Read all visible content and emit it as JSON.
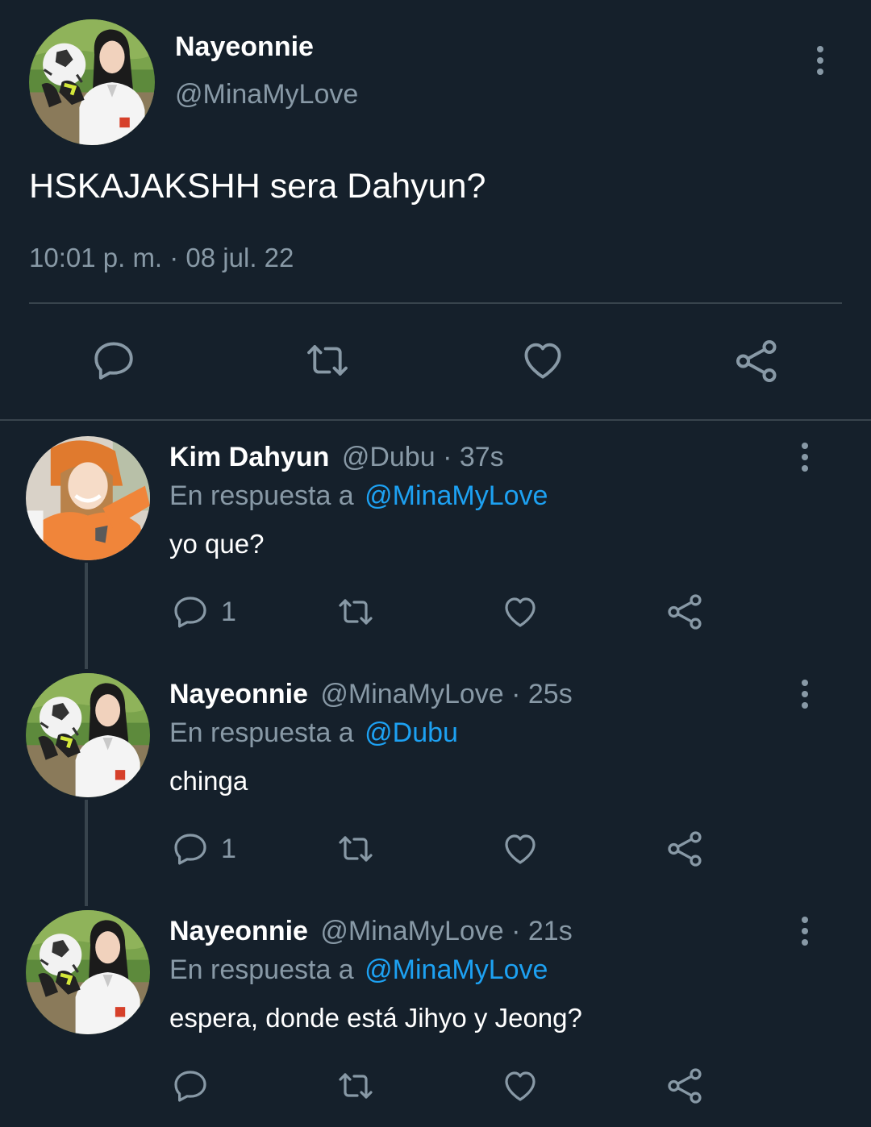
{
  "main_tweet": {
    "display_name": "Nayeonnie",
    "handle": "@MinaMyLove",
    "text": "HSKAJAKSHH sera Dahyun?",
    "timestamp": "10:01 p. m. · 08 jul. 22"
  },
  "replies": [
    {
      "display_name": "Kim Dahyun",
      "handle": "@Dubu",
      "time": "· 37s",
      "reply_prefix": "En respuesta a",
      "reply_to": "@MinaMyLove",
      "text": "yo que?",
      "reply_count": "1"
    },
    {
      "display_name": "Nayeonnie",
      "handle": "@MinaMyLove",
      "time": "· 25s",
      "reply_prefix": "En respuesta a",
      "reply_to": "@Dubu",
      "text": "chinga",
      "reply_count": "1"
    },
    {
      "display_name": "Nayeonnie",
      "handle": "@MinaMyLove",
      "time": "· 21s",
      "reply_prefix": "En respuesta a",
      "reply_to": "@MinaMyLove",
      "text": "espera, donde está Jihyo y Jeong?",
      "reply_count": ""
    }
  ],
  "icons": {
    "reply": "speech-bubble-icon",
    "retweet": "retweet-icon",
    "like": "heart-icon",
    "share": "share-icon",
    "more": "kebab-menu-icon"
  },
  "colors": {
    "background": "#15202b",
    "text": "#ffffff",
    "muted": "#8899a6",
    "link": "#1da1f2",
    "divider": "#38444d"
  }
}
